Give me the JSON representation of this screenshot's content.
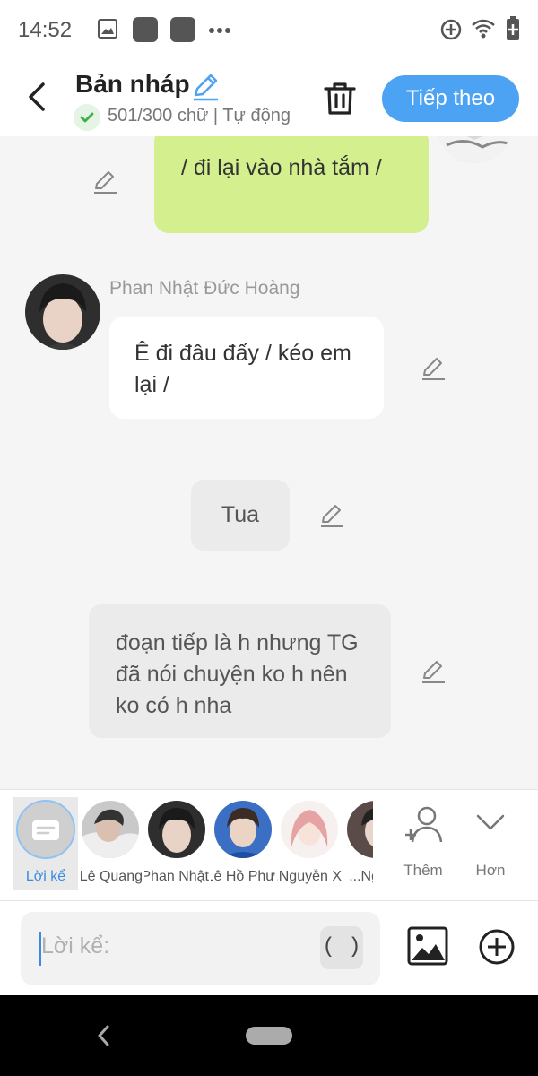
{
  "status_bar": {
    "time": "14:52",
    "icons": [
      "image-icon",
      "app-icon",
      "app-icon",
      "more-dots-icon",
      "data-saver-icon",
      "wifi-icon",
      "battery-icon"
    ]
  },
  "header": {
    "title": "Bản nháp",
    "counter": "501/300 chữ | Tự động",
    "next_label": "Tiếp theo",
    "colors": {
      "accent": "#4da3f3",
      "check_green": "#3cb043"
    }
  },
  "chat": {
    "messages": [
      {
        "kind": "self",
        "text": "/ đi lại vào nhà tắm /",
        "color": "#d3ef8e"
      },
      {
        "kind": "character",
        "sender": "Phan Nhật Đức Hoàng",
        "text": "Ê đi đâu đấy / kéo em lại /"
      },
      {
        "kind": "action",
        "text": "Tua"
      },
      {
        "kind": "narration",
        "text": "đoạn tiếp là h nhưng TG đã nói chuyện ko h nên ko có h nha"
      }
    ]
  },
  "characters": {
    "narrator_label": "Lời kể",
    "items": [
      {
        "name": "Lê Quang ..."
      },
      {
        "name": "Phan Nhật..."
      },
      {
        "name": "Lê Hồ Phư..."
      },
      {
        "name": "Nguyễn X..."
      },
      {
        "name": "Nguyễ..."
      }
    ],
    "add_label": "Thêm",
    "more_label": "Hơn"
  },
  "input": {
    "placeholder": "Lời kể:",
    "paren_label": "( )"
  }
}
